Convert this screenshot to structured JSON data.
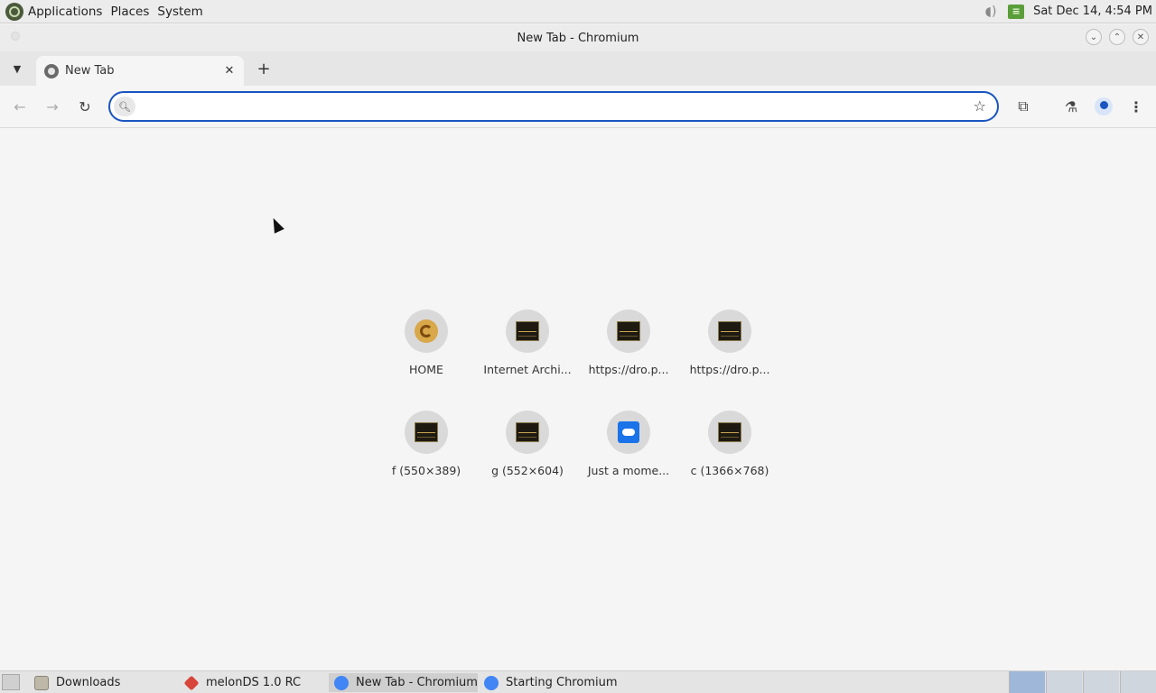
{
  "top_panel": {
    "menus": [
      "Applications",
      "Places",
      "System"
    ],
    "clock": "Sat Dec 14,  4:54 PM"
  },
  "window": {
    "title": "New Tab - Chromium"
  },
  "tabs": [
    {
      "title": "New Tab"
    }
  ],
  "omnibox": {
    "value": "",
    "placeholder": ""
  },
  "shortcuts": [
    {
      "label": "HOME",
      "icon": "home-logo"
    },
    {
      "label": "Internet Archi...",
      "icon": "thumbnail"
    },
    {
      "label": "https://dro.p...",
      "icon": "thumbnail"
    },
    {
      "label": "https://dro.p...",
      "icon": "thumbnail"
    },
    {
      "label": "f (550×389)",
      "icon": "thumbnail"
    },
    {
      "label": "g (552×604)",
      "icon": "thumbnail"
    },
    {
      "label": "Just a mome...",
      "icon": "blue-logo"
    },
    {
      "label": "c (1366×768)",
      "icon": "thumbnail"
    }
  ],
  "taskbar": {
    "items": [
      {
        "label": "Downloads",
        "icon": "folder-icon",
        "active": false
      },
      {
        "label": "melonDS 1.0 RC",
        "icon": "melonds-icon",
        "active": false
      },
      {
        "label": "New Tab - Chromium",
        "icon": "chromium-icon",
        "active": true
      },
      {
        "label": "Starting Chromium",
        "icon": "chromium-icon",
        "active": false
      }
    ]
  },
  "colors": {
    "accent": "#1a55c0",
    "panel": "#ececec",
    "content_bg": "#f5f5f5"
  }
}
